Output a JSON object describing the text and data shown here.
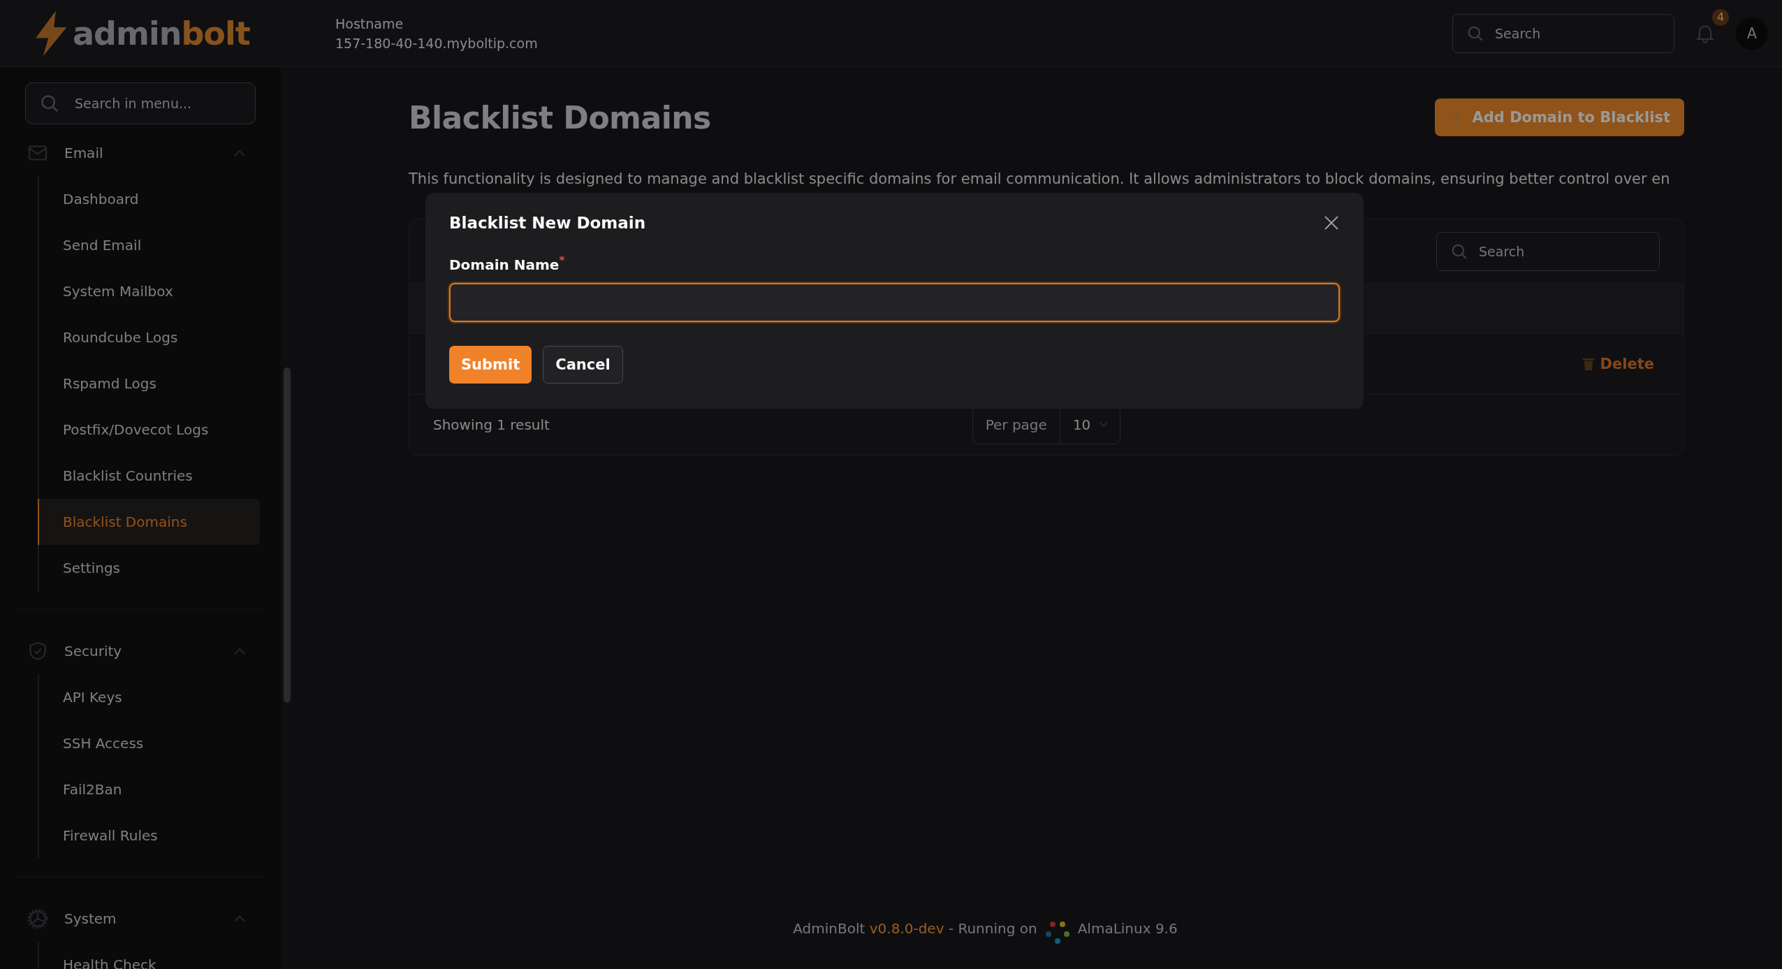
{
  "header": {
    "logo": {
      "part_1": "admin",
      "part_2": "bolt"
    },
    "hostname_label": "Hostname",
    "hostname": "157-180-40-140.myboltip.com",
    "search": {
      "placeholder": "Search"
    },
    "notifications": {
      "count": "4"
    },
    "avatar": "A"
  },
  "sidebar": {
    "search": {
      "placeholder": "Search in menu..."
    },
    "groups": [
      {
        "label": "Email",
        "kind": "envelope",
        "expanded": true,
        "items": [
          {
            "label": "Dashboard",
            "selected": false
          },
          {
            "label": "Send Email",
            "selected": false
          },
          {
            "label": "System Mailbox",
            "selected": false
          },
          {
            "label": "Roundcube Logs",
            "selected": false
          },
          {
            "label": "Rspamd Logs",
            "selected": false
          },
          {
            "label": "Postfix/Dovecot Logs",
            "selected": false
          },
          {
            "label": "Blacklist Countries",
            "selected": false
          },
          {
            "label": "Blacklist Domains",
            "selected": true
          },
          {
            "label": "Settings",
            "selected": false
          }
        ]
      },
      {
        "label": "Security",
        "kind": "shield",
        "expanded": true,
        "items": [
          {
            "label": "API Keys",
            "selected": false
          },
          {
            "label": "SSH Access",
            "selected": false
          },
          {
            "label": "Fail2Ban",
            "selected": false
          },
          {
            "label": "Firewall Rules",
            "selected": false
          }
        ]
      },
      {
        "label": "System",
        "kind": "gear",
        "expanded": true,
        "items": [
          {
            "label": "Health Check",
            "selected": false
          }
        ]
      }
    ]
  },
  "page": {
    "title": "Blacklist Domains",
    "add_button": "Add Domain to Blacklist",
    "description": "This functionality is designed to manage and blacklist specific domains for email communication. It allows administrators to block domains, ensuring better control over en",
    "table": {
      "search": {
        "placeholder": "Search"
      },
      "row_action": "Delete",
      "summary": "Showing 1 result",
      "per_page": {
        "label": "Per page",
        "value": "10"
      }
    }
  },
  "modal": {
    "title": "Blacklist New Domain",
    "field": {
      "label": "Domain Name",
      "required_mark": "*"
    },
    "buttons": [
      {
        "label": "Submit",
        "kind": "primary"
      },
      {
        "label": "Cancel",
        "kind": "secondary"
      }
    ]
  },
  "footer": {
    "app": "AdminBolt",
    "version": "v0.8.0-dev",
    "running": "- Running on",
    "os": "AlmaLinux 9.6"
  }
}
